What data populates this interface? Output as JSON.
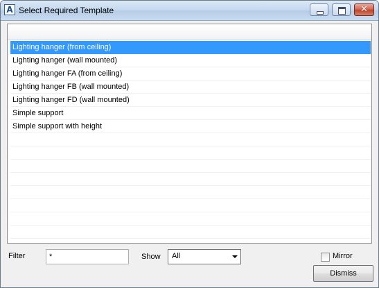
{
  "window": {
    "title": "Select Required Template",
    "app_icon_glyph": "A",
    "icons": {
      "app": "app-logo-icon",
      "minimize": "minimize-icon",
      "maximize": "maximize-icon",
      "close": "close-icon"
    },
    "close_glyph": "✕"
  },
  "templates": {
    "selected_index": 0,
    "items": [
      {
        "label": "Lighting hanger (from ceiling)"
      },
      {
        "label": "Lighting hanger (wall mounted)"
      },
      {
        "label": "Lighting hanger FA (from ceiling)"
      },
      {
        "label": "Lighting hanger FB (wall mounted)"
      },
      {
        "label": "Lighting hanger FD (wall mounted)"
      },
      {
        "label": "Simple support"
      },
      {
        "label": "Simple support with height"
      }
    ],
    "selection_color": "#3399ff"
  },
  "filter": {
    "label": "Filter",
    "value": "*"
  },
  "show": {
    "label": "Show",
    "value": "All"
  },
  "mirror": {
    "label": "Mirror",
    "checked": false
  },
  "dismiss": {
    "label": "Dismiss"
  }
}
